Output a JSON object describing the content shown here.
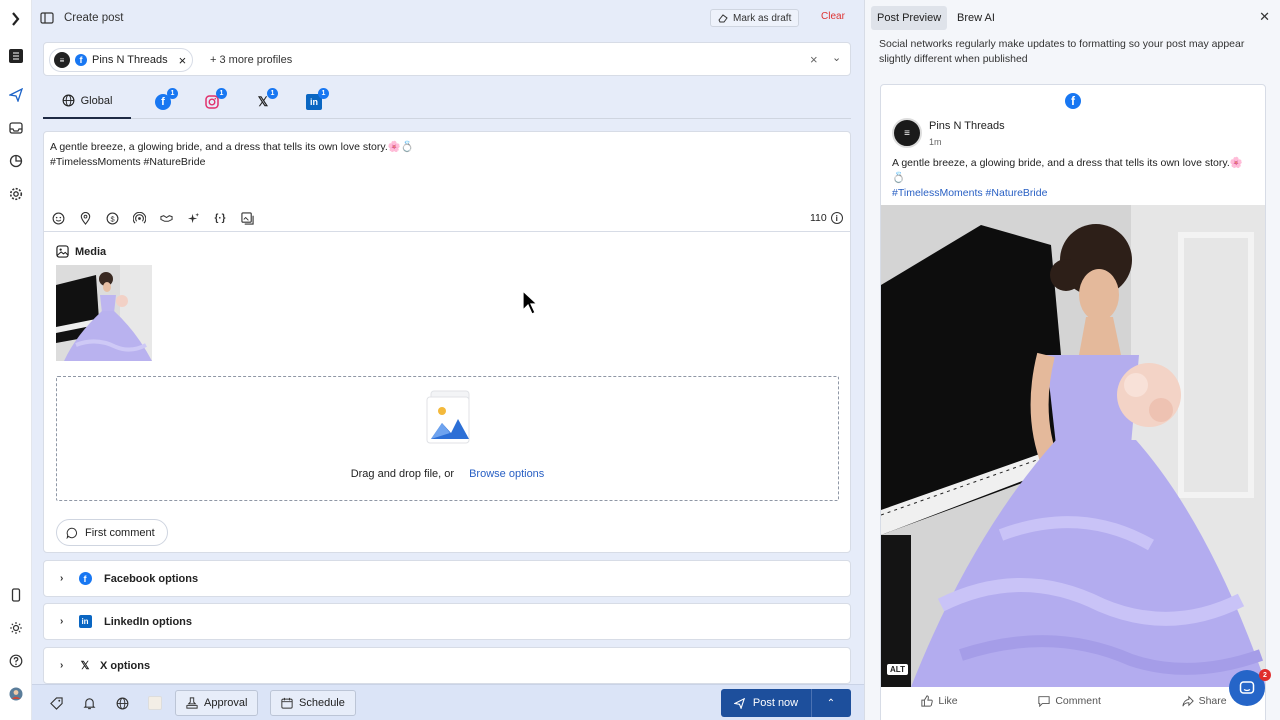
{
  "header": {
    "title": "Create post",
    "draft_label": "Mark as draft",
    "clear_label": "Clear"
  },
  "profiles": {
    "chip_label": "Pins N Threads",
    "more_label": "+ 3 more profiles"
  },
  "tabs": {
    "global_label": "Global",
    "networks": [
      {
        "name": "facebook",
        "badge": "1"
      },
      {
        "name": "instagram",
        "badge": "1"
      },
      {
        "name": "x",
        "badge": "1"
      },
      {
        "name": "linkedin",
        "badge": "1"
      }
    ]
  },
  "editor": {
    "text_line1": "A gentle breeze, a glowing bride, and a dress that tells its own love story.🌸💍",
    "text_line2": "#TimelessMoments #NatureBride",
    "char_count": "110",
    "media_label": "Media",
    "dropzone_text": "Drag and drop file, or",
    "browse_label": "Browse options",
    "first_comment_label": "First comment"
  },
  "options": {
    "facebook_label": "Facebook options",
    "linkedin_label": "LinkedIn options",
    "x_label": "X options"
  },
  "footer": {
    "approval_label": "Approval",
    "schedule_label": "Schedule",
    "post_now_label": "Post now"
  },
  "preview": {
    "tab_preview": "Post Preview",
    "tab_brew": "Brew AI",
    "note": "Social networks regularly make updates to formatting so your post may appear slightly different when published",
    "page_name": "Pins N Threads",
    "time": "1m",
    "text": "A gentle breeze, a glowing bride, and a dress that tells its own love story.🌸💍",
    "tags": "#TimelessMoments #NatureBride",
    "alt_label": "ALT",
    "like_label": "Like",
    "comment_label": "Comment",
    "share_label": "Share",
    "chat_badge": "2"
  },
  "colors": {
    "accent": "#1d4f9c",
    "facebook": "#1877f2",
    "link": "#2960c4",
    "clear": "#dd3333",
    "dress": "#b6b0ee"
  }
}
